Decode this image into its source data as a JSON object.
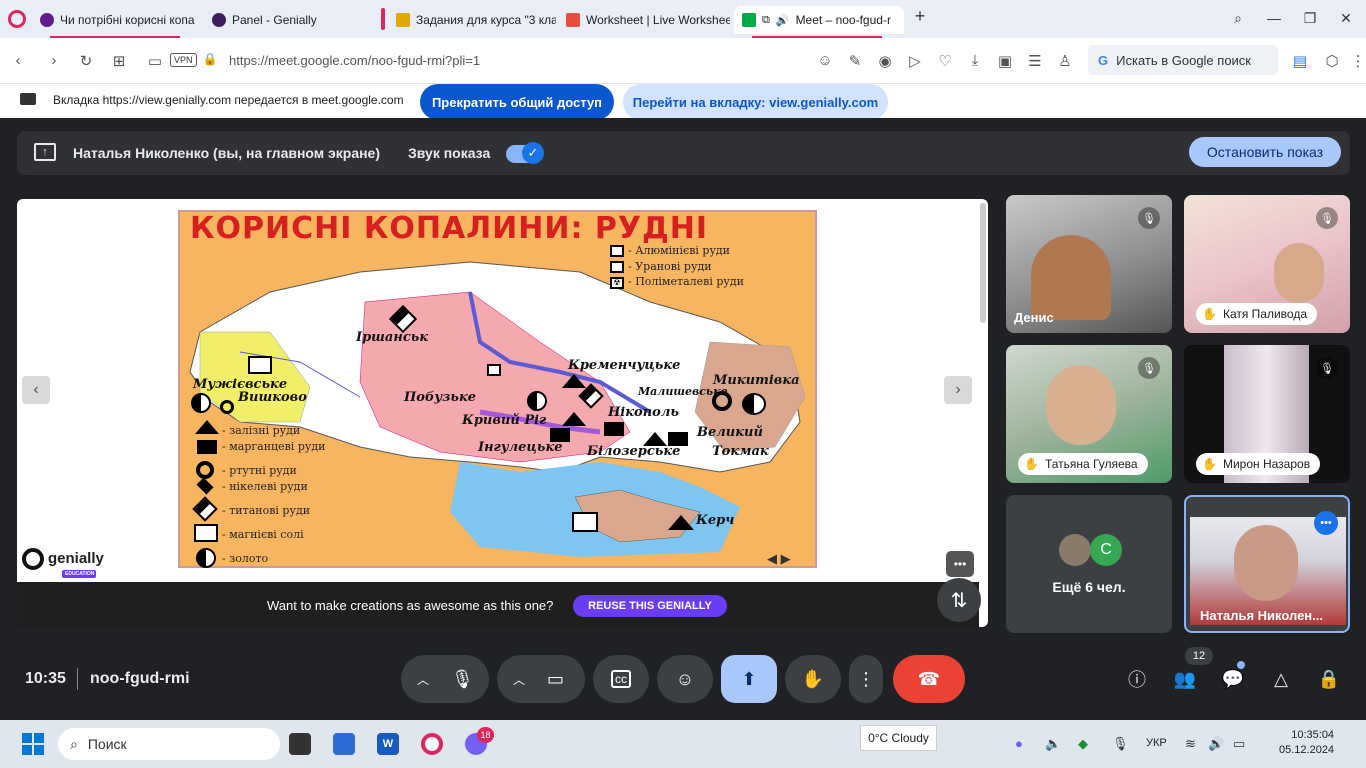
{
  "browser": {
    "tabs": [
      {
        "title": "Чи потрібні корисні копа",
        "fav": "#5f1e8c"
      },
      {
        "title": "Panel - Genially",
        "fav": "#3c1e5c"
      },
      {
        "title": "Задания для курса \"3 кла",
        "fav": "#e0a800"
      },
      {
        "title": "Worksheet | Live Workshee",
        "fav": "#e74c3c"
      },
      {
        "title": "Meet – noo-fgud-r",
        "fav": "#00ac47"
      }
    ],
    "new_tab": "+",
    "vpn": "VPN",
    "url": "https://meet.google.com/noo-fgud-rmi?pli=1",
    "search_box": "Искать в Google поиск"
  },
  "share_bar": {
    "text": "Вкладка https://view.genially.com передается в meet.google.com",
    "stop_label": "Прекратить общий доступ",
    "goto_label": "Перейти на вкладку: view.genially.com"
  },
  "presentation_bar": {
    "presenter": "Наталья Николенко (вы, на главном экране)",
    "sound_label": "Звук показа",
    "stop_label": "Остановить показ"
  },
  "slide": {
    "title": "КОРИСНІ КОПАЛИНИ: РУДНІ",
    "legend_top": [
      "- Алюмінієві руди",
      "- Уранові руди",
      "- Поліметалеві руди"
    ],
    "legend_left": [
      "- залізні руди",
      "- марганцеві руди",
      "- ртутні руди",
      "- нікелеві руди",
      "- титанові руди",
      "- магнієві солі",
      "- золото"
    ],
    "cities": [
      "Іршанськ",
      "Мужієвське",
      "Вишково",
      "Побузьке",
      "Кривий Ріг",
      "Кременчуцьке",
      "Малишевське",
      "Нікополь",
      "Микитівка",
      "Великий",
      "Токмак",
      "Інгулецьке",
      "Білозерське",
      "Керч"
    ],
    "logo": "genially",
    "logo_sub": "EDUCATION",
    "cta_text": "Want to make creations as awesome as this one?",
    "cta_button": "REUSE THIS GENIALLY"
  },
  "participants": [
    {
      "name": "Денис"
    },
    {
      "name": "Катя Паливода"
    },
    {
      "name": "Татьяна Гуляева"
    },
    {
      "name": "Мирон Назаров"
    },
    {
      "name": "Ещё 6 чел.",
      "avatar_letter": "С"
    },
    {
      "name": "Наталья Николен..."
    }
  ],
  "controls": {
    "time": "10:35",
    "meeting_code": "noo-fgud-rmi",
    "people_count": "12"
  },
  "taskbar": {
    "search": "Поиск",
    "viber_badge": "18",
    "weather": "0°C Cloudy",
    "lang": "УКР",
    "time": "10:35:04",
    "date": "05.12.2024"
  }
}
